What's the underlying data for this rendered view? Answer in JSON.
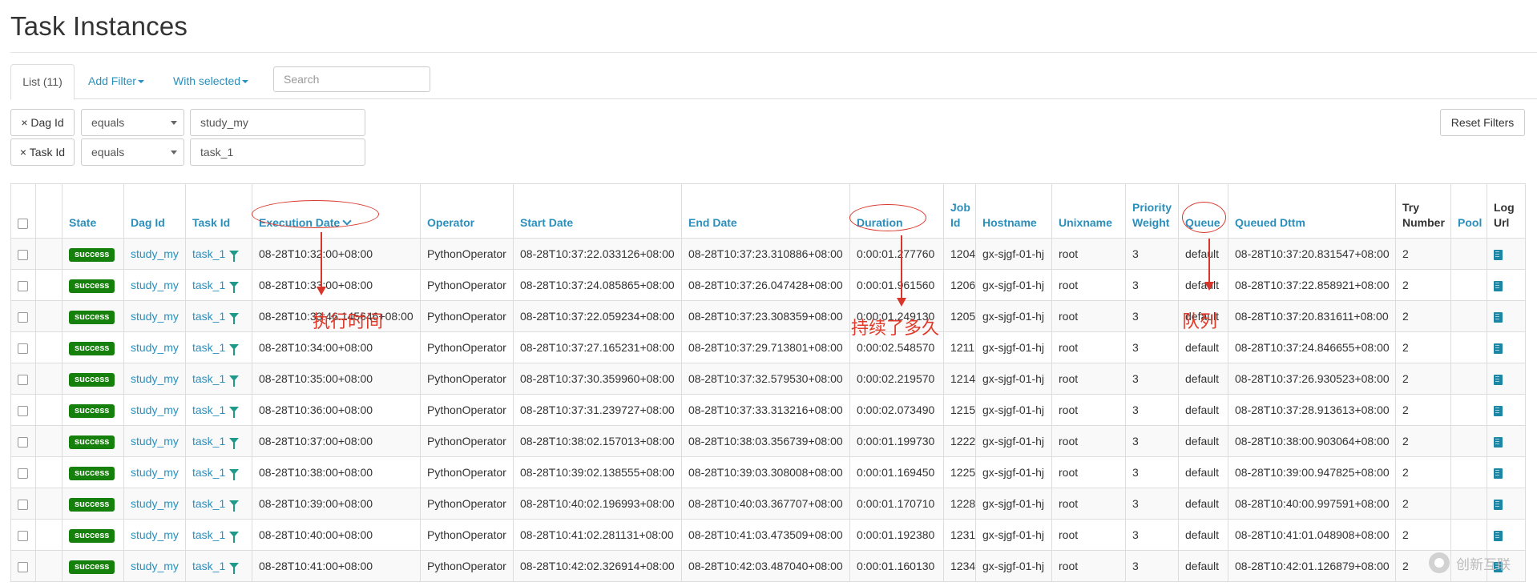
{
  "page_title": "Task Instances",
  "tabs": {
    "list": "List (11)",
    "add_filter": "Add Filter",
    "with_selected": "With selected"
  },
  "search": {
    "placeholder": "Search"
  },
  "filters": [
    {
      "chip": "× Dag Id",
      "operator": "equals",
      "value": "study_my"
    },
    {
      "chip": "× Task Id",
      "operator": "equals",
      "value": "task_1"
    }
  ],
  "reset_filters": "Reset Filters",
  "columns": {
    "state": "State",
    "dag_id": "Dag Id",
    "task_id": "Task Id",
    "execution_date": "Execution Date",
    "operator": "Operator",
    "start_date": "Start Date",
    "end_date": "End Date",
    "duration": "Duration",
    "job_id": "Job Id",
    "hostname": "Hostname",
    "unixname": "Unixname",
    "priority_weight": "Priority Weight",
    "queue": "Queue",
    "queued_dttm": "Queued Dttm",
    "try_number": "Try Number",
    "pool": "Pool",
    "log_url": "Log Url"
  },
  "rows": [
    {
      "state": "success",
      "dag_id": "study_my",
      "task_id": "task_1",
      "execution_date": "08-28T10:32:00+08:00",
      "operator": "PythonOperator",
      "start_date": "08-28T10:37:22.033126+08:00",
      "end_date": "08-28T10:37:23.310886+08:00",
      "duration": "0:00:01.277760",
      "job_id": "1204",
      "hostname": "gx-sjgf-01-hj",
      "unixname": "root",
      "priority_weight": "3",
      "queue": "default",
      "queued_dttm": "08-28T10:37:20.831547+08:00",
      "try_number": "2",
      "pool": ""
    },
    {
      "state": "success",
      "dag_id": "study_my",
      "task_id": "task_1",
      "execution_date": "08-28T10:33:00+08:00",
      "operator": "PythonOperator",
      "start_date": "08-28T10:37:24.085865+08:00",
      "end_date": "08-28T10:37:26.047428+08:00",
      "duration": "0:00:01.961560",
      "job_id": "1206",
      "hostname": "gx-sjgf-01-hj",
      "unixname": "root",
      "priority_weight": "3",
      "queue": "default",
      "queued_dttm": "08-28T10:37:22.858921+08:00",
      "try_number": "2",
      "pool": ""
    },
    {
      "state": "success",
      "dag_id": "study_my",
      "task_id": "task_1",
      "execution_date": "08-28T10:33:46.145646+08:00",
      "operator": "PythonOperator",
      "start_date": "08-28T10:37:22.059234+08:00",
      "end_date": "08-28T10:37:23.308359+08:00",
      "duration": "0:00:01.249130",
      "job_id": "1205",
      "hostname": "gx-sjgf-01-hj",
      "unixname": "root",
      "priority_weight": "3",
      "queue": "default",
      "queued_dttm": "08-28T10:37:20.831611+08:00",
      "try_number": "2",
      "pool": ""
    },
    {
      "state": "success",
      "dag_id": "study_my",
      "task_id": "task_1",
      "execution_date": "08-28T10:34:00+08:00",
      "operator": "PythonOperator",
      "start_date": "08-28T10:37:27.165231+08:00",
      "end_date": "08-28T10:37:29.713801+08:00",
      "duration": "0:00:02.548570",
      "job_id": "1211",
      "hostname": "gx-sjgf-01-hj",
      "unixname": "root",
      "priority_weight": "3",
      "queue": "default",
      "queued_dttm": "08-28T10:37:24.846655+08:00",
      "try_number": "2",
      "pool": ""
    },
    {
      "state": "success",
      "dag_id": "study_my",
      "task_id": "task_1",
      "execution_date": "08-28T10:35:00+08:00",
      "operator": "PythonOperator",
      "start_date": "08-28T10:37:30.359960+08:00",
      "end_date": "08-28T10:37:32.579530+08:00",
      "duration": "0:00:02.219570",
      "job_id": "1214",
      "hostname": "gx-sjgf-01-hj",
      "unixname": "root",
      "priority_weight": "3",
      "queue": "default",
      "queued_dttm": "08-28T10:37:26.930523+08:00",
      "try_number": "2",
      "pool": ""
    },
    {
      "state": "success",
      "dag_id": "study_my",
      "task_id": "task_1",
      "execution_date": "08-28T10:36:00+08:00",
      "operator": "PythonOperator",
      "start_date": "08-28T10:37:31.239727+08:00",
      "end_date": "08-28T10:37:33.313216+08:00",
      "duration": "0:00:02.073490",
      "job_id": "1215",
      "hostname": "gx-sjgf-01-hj",
      "unixname": "root",
      "priority_weight": "3",
      "queue": "default",
      "queued_dttm": "08-28T10:37:28.913613+08:00",
      "try_number": "2",
      "pool": ""
    },
    {
      "state": "success",
      "dag_id": "study_my",
      "task_id": "task_1",
      "execution_date": "08-28T10:37:00+08:00",
      "operator": "PythonOperator",
      "start_date": "08-28T10:38:02.157013+08:00",
      "end_date": "08-28T10:38:03.356739+08:00",
      "duration": "0:00:01.199730",
      "job_id": "1222",
      "hostname": "gx-sjgf-01-hj",
      "unixname": "root",
      "priority_weight": "3",
      "queue": "default",
      "queued_dttm": "08-28T10:38:00.903064+08:00",
      "try_number": "2",
      "pool": ""
    },
    {
      "state": "success",
      "dag_id": "study_my",
      "task_id": "task_1",
      "execution_date": "08-28T10:38:00+08:00",
      "operator": "PythonOperator",
      "start_date": "08-28T10:39:02.138555+08:00",
      "end_date": "08-28T10:39:03.308008+08:00",
      "duration": "0:00:01.169450",
      "job_id": "1225",
      "hostname": "gx-sjgf-01-hj",
      "unixname": "root",
      "priority_weight": "3",
      "queue": "default",
      "queued_dttm": "08-28T10:39:00.947825+08:00",
      "try_number": "2",
      "pool": ""
    },
    {
      "state": "success",
      "dag_id": "study_my",
      "task_id": "task_1",
      "execution_date": "08-28T10:39:00+08:00",
      "operator": "PythonOperator",
      "start_date": "08-28T10:40:02.196993+08:00",
      "end_date": "08-28T10:40:03.367707+08:00",
      "duration": "0:00:01.170710",
      "job_id": "1228",
      "hostname": "gx-sjgf-01-hj",
      "unixname": "root",
      "priority_weight": "3",
      "queue": "default",
      "queued_dttm": "08-28T10:40:00.997591+08:00",
      "try_number": "2",
      "pool": ""
    },
    {
      "state": "success",
      "dag_id": "study_my",
      "task_id": "task_1",
      "execution_date": "08-28T10:40:00+08:00",
      "operator": "PythonOperator",
      "start_date": "08-28T10:41:02.281131+08:00",
      "end_date": "08-28T10:41:03.473509+08:00",
      "duration": "0:00:01.192380",
      "job_id": "1231",
      "hostname": "gx-sjgf-01-hj",
      "unixname": "root",
      "priority_weight": "3",
      "queue": "default",
      "queued_dttm": "08-28T10:41:01.048908+08:00",
      "try_number": "2",
      "pool": ""
    },
    {
      "state": "success",
      "dag_id": "study_my",
      "task_id": "task_1",
      "execution_date": "08-28T10:41:00+08:00",
      "operator": "PythonOperator",
      "start_date": "08-28T10:42:02.326914+08:00",
      "end_date": "08-28T10:42:03.487040+08:00",
      "duration": "0:00:01.160130",
      "job_id": "1234",
      "hostname": "gx-sjgf-01-hj",
      "unixname": "root",
      "priority_weight": "3",
      "queue": "default",
      "queued_dttm": "08-28T10:42:01.126879+08:00",
      "try_number": "2",
      "pool": ""
    }
  ],
  "annotations": {
    "execution_date": "执行时间",
    "duration": "持续了多久",
    "queue": "队列"
  },
  "watermark": "创新互联",
  "colors": {
    "link": "#2a8fbd",
    "success_badge": "#15800b",
    "annotation": "#d9362b",
    "filter_icon": "#1f9a8a",
    "log_icon": "#1b87a5"
  },
  "icons": {
    "filter": "funnel-icon",
    "sort": "chevron-down-icon",
    "log": "log-file-icon"
  }
}
